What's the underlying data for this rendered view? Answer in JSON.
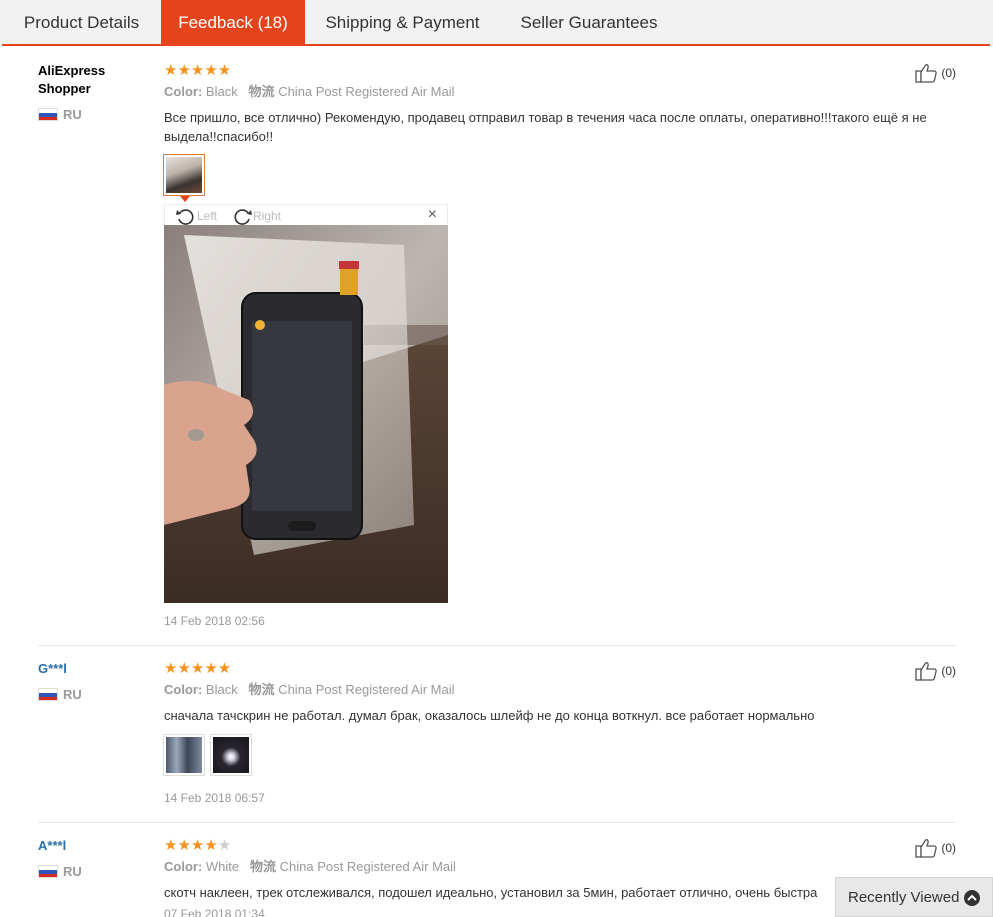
{
  "tabs": [
    {
      "label": "Product Details"
    },
    {
      "label": "Feedback (18)"
    },
    {
      "label": "Shipping & Payment"
    },
    {
      "label": "Seller Guarantees"
    }
  ],
  "colors": {
    "accent": "#e5431c",
    "star": "#f6921e",
    "user_link": "#2a6ea6"
  },
  "reviews": [
    {
      "name": "AliExpress Shopper",
      "country": "RU",
      "rating": 5,
      "stars": "★★★★★",
      "stars_off": "",
      "color_label": "Color:",
      "color_value": "Black",
      "logistics_label": "物流",
      "logistics_value": "China Post Registered Air Mail",
      "text": "Все пришло, все отлично) Рекомендую, продавец отправил товар в течения часа после оплаты, оперативно!!!такого ещё я не выдела!!спасибо!!",
      "date": "14 Feb 2018 02:56",
      "likes": "(0)"
    },
    {
      "name": "G***l",
      "country": "RU",
      "rating": 5,
      "stars": "★★★★★",
      "stars_off": "",
      "color_label": "Color:",
      "color_value": "Black",
      "logistics_label": "物流",
      "logistics_value": "China Post Registered Air Mail",
      "text": "сначала тачскрин не работал. думал брак, оказалось шлейф не до конца воткнул. все работает нормально",
      "date": "14 Feb 2018 06:57",
      "likes": "(0)"
    },
    {
      "name": "A***l",
      "country": "RU",
      "rating": 4,
      "stars": "★★★★",
      "stars_off": "★",
      "color_label": "Color:",
      "color_value": "White",
      "logistics_label": "物流",
      "logistics_value": "China Post Registered Air Mail",
      "text": "скотч наклеен, трек отслеживался, подошел идеально, установил за 5мин, работает отлично, очень быстра",
      "date": "07 Feb 2018 01:34",
      "likes": "(0)"
    }
  ],
  "viewer": {
    "left_label": "Left",
    "right_label": "Right",
    "close": "×"
  },
  "recently_viewed": "Recently Viewed"
}
